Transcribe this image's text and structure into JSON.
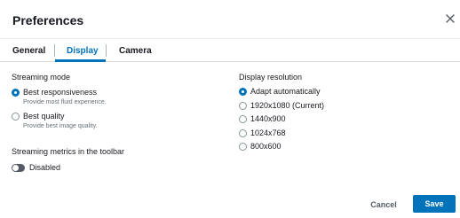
{
  "dialog": {
    "title": "Preferences",
    "close_icon": "close-icon"
  },
  "tabs": [
    {
      "label": "General",
      "active": false
    },
    {
      "label": "Display",
      "active": true
    },
    {
      "label": "Camera",
      "active": false
    }
  ],
  "streaming_mode": {
    "label": "Streaming mode",
    "options": [
      {
        "label": "Best responsiveness",
        "description": "Provide most fluid experience.",
        "checked": true
      },
      {
        "label": "Best quality",
        "description": "Provide best image quality.",
        "checked": false
      }
    ]
  },
  "metrics": {
    "label": "Streaming metrics in the toolbar",
    "toggle_label": "Disabled",
    "enabled": false
  },
  "display_resolution": {
    "label": "Display resolution",
    "options": [
      {
        "label": "Adapt automatically",
        "checked": true
      },
      {
        "label": "1920x1080 (Current)",
        "checked": false
      },
      {
        "label": "1440x900",
        "checked": false
      },
      {
        "label": "1024x768",
        "checked": false
      },
      {
        "label": "800x600",
        "checked": false
      }
    ]
  },
  "footer": {
    "cancel_label": "Cancel",
    "save_label": "Save"
  },
  "colors": {
    "accent": "#0073bb",
    "text": "#16191f",
    "muted": "#687078",
    "toggle_off": "#545b64"
  }
}
